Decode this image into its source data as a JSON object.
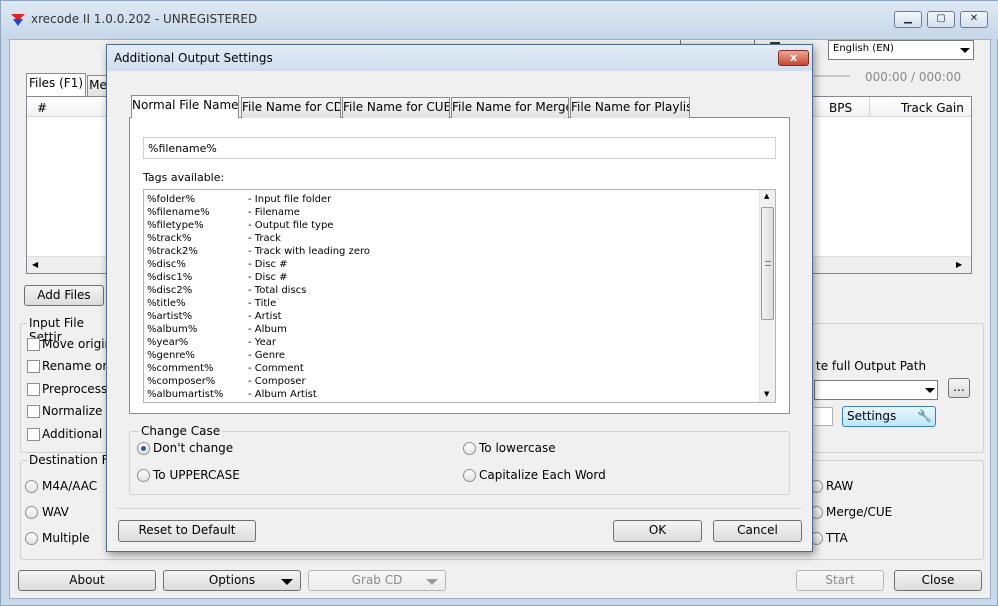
{
  "main": {
    "title": "xrecode II 1.0.0.202 - UNREGISTERED",
    "language": "English (EN)",
    "time_display": "000:00 / 000:00",
    "tabs": [
      "Files (F1)",
      "Me"
    ],
    "list_columns": {
      "num": "#",
      "bps": "BPS",
      "track_gain": "Track Gain"
    },
    "add_files": "Add Files",
    "input_settings": {
      "title": "Input File Settir",
      "options": [
        "Move origin",
        "Rename orig",
        "Preprocessin",
        "Normalize",
        "Additional"
      ]
    },
    "destination": {
      "title": "Destination For",
      "left": [
        "M4A/AAC",
        "WAV",
        "Multiple"
      ],
      "right": [
        "RAW",
        "Merge/CUE",
        "TTA"
      ]
    },
    "output_path_label": "te full Output Path",
    "browse": "...",
    "settings_button": "Settings",
    "bottom": {
      "about": "About",
      "options": "Options",
      "grab_cd": "Grab CD",
      "start": "Start",
      "close": "Close"
    }
  },
  "dialog": {
    "title": "Additional Output Settings",
    "close_glyph": "x",
    "tabs": [
      "Normal File Name",
      "File Name for CD",
      "File Name for CUE",
      "File Name for Merge",
      "File Name for Playlist"
    ],
    "pattern_value": "%filename%",
    "tags_label": "Tags available:",
    "tags": [
      {
        "tag": "%folder%",
        "desc": "- Input file folder"
      },
      {
        "tag": "%filename%",
        "desc": "- Filename"
      },
      {
        "tag": "%filetype%",
        "desc": "- Output file type"
      },
      {
        "tag": "%track%",
        "desc": "- Track"
      },
      {
        "tag": "%track2%",
        "desc": "- Track with leading zero"
      },
      {
        "tag": "%disc%",
        "desc": "- Disc #"
      },
      {
        "tag": "%disc1%",
        "desc": "- Disc #"
      },
      {
        "tag": "%disc2%",
        "desc": "- Total discs"
      },
      {
        "tag": "%title%",
        "desc": "- Title"
      },
      {
        "tag": "%artist%",
        "desc": "- Artist"
      },
      {
        "tag": "%album%",
        "desc": "- Album"
      },
      {
        "tag": "%year%",
        "desc": "- Year"
      },
      {
        "tag": "%genre%",
        "desc": "- Genre"
      },
      {
        "tag": "%comment%",
        "desc": "- Comment"
      },
      {
        "tag": "%composer%",
        "desc": "- Composer"
      },
      {
        "tag": "%albumartist%",
        "desc": "- Album Artist"
      }
    ],
    "change_case": {
      "title": "Change Case",
      "options": [
        "Don't change",
        "To lowercase",
        "To UPPERCASE",
        "Capitalize Each Word"
      ],
      "selected": "Don't change"
    },
    "reset": "Reset to Default",
    "ok": "OK",
    "cancel": "Cancel"
  }
}
